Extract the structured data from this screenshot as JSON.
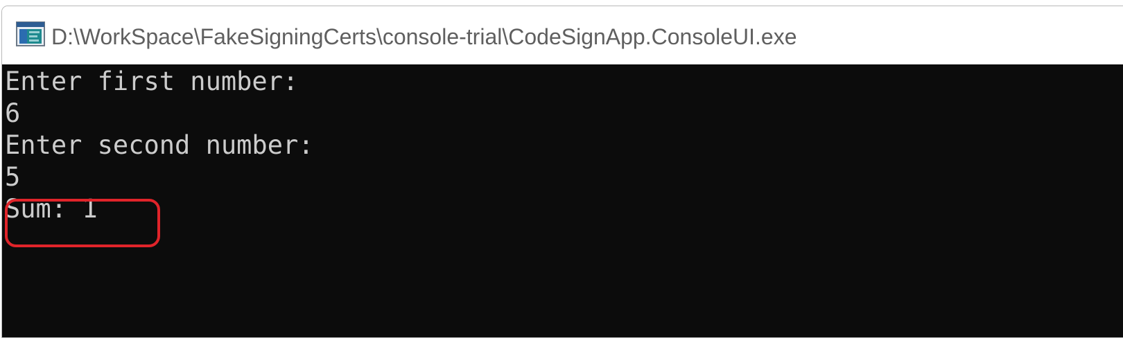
{
  "window": {
    "title": "D:\\WorkSpace\\FakeSigningCerts\\console-trial\\CodeSignApp.ConsoleUI.exe",
    "icon": "console-app-icon"
  },
  "console": {
    "lines": [
      "Enter first number:",
      "6",
      "Enter second number:",
      "5",
      "Sum: 1"
    ],
    "background": "#0c0c0c",
    "foreground": "#cccccc"
  },
  "annotation": {
    "color": "#e0242a"
  }
}
